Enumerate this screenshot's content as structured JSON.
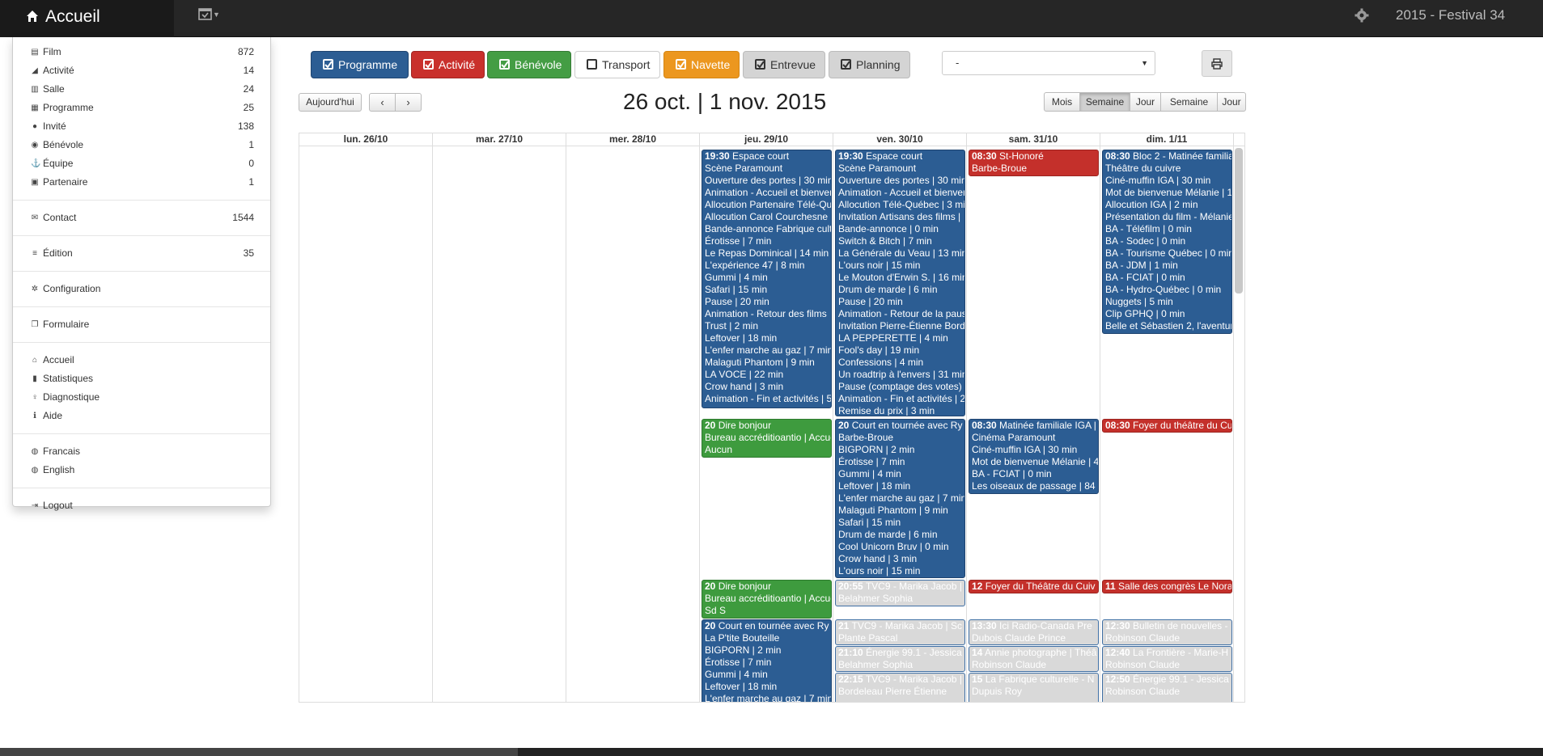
{
  "app": {
    "brand": "Accueil",
    "festival": "2015 - Festival 34"
  },
  "menu": {
    "group1": [
      {
        "label": "Film",
        "count": "872",
        "icon": "film-icon"
      },
      {
        "label": "Activité",
        "count": "14",
        "icon": "bullhorn-icon"
      },
      {
        "label": "Salle",
        "count": "24",
        "icon": "building-icon"
      },
      {
        "label": "Programme",
        "count": "25",
        "icon": "calendar-icon"
      },
      {
        "label": "Invité",
        "count": "138",
        "icon": "user-icon"
      },
      {
        "label": "Bénévole",
        "count": "1",
        "icon": "users-icon"
      },
      {
        "label": "Équipe",
        "count": "0",
        "icon": "anchor-icon"
      },
      {
        "label": "Partenaire",
        "count": "1",
        "icon": "money-icon"
      }
    ],
    "contact": {
      "label": "Contact",
      "count": "1544"
    },
    "edition": {
      "label": "Édition",
      "count": "35"
    },
    "configuration": "Configuration",
    "formulaire": "Formulaire",
    "group2": [
      {
        "label": "Accueil",
        "icon": "home-icon"
      },
      {
        "label": "Statistiques",
        "icon": "bar-chart-icon"
      },
      {
        "label": "Diagnostique",
        "icon": "lightbulb-icon"
      },
      {
        "label": "Aide",
        "icon": "info-icon"
      }
    ],
    "lang": [
      "Francais",
      "English"
    ],
    "logout": "Logout"
  },
  "toolbar": [
    {
      "label": "Programme",
      "bg": "#2c5d93",
      "fg": "#ffffff",
      "border": "#1f4470"
    },
    {
      "label": "Activité",
      "bg": "#c9302c",
      "fg": "#ffffff",
      "border": "#a02622"
    },
    {
      "label": "Bénévole",
      "bg": "#449d44",
      "fg": "#ffffff",
      "border": "#357a35"
    },
    {
      "label": "Transport",
      "bg": "#ffffff",
      "fg": "#333333",
      "border": "#cccccc"
    },
    {
      "label": "Navette",
      "bg": "#ec971f",
      "fg": "#ffffff",
      "border": "#d58512"
    },
    {
      "label": "Entrevue",
      "bg": "#d4d4d4",
      "fg": "#333333",
      "border": "#bbbbbb"
    },
    {
      "label": "Planning",
      "bg": "#d4d4d4",
      "fg": "#333333",
      "border": "#bbbbbb"
    }
  ],
  "select": {
    "value": "-"
  },
  "calendar": {
    "today": "Aujourd'hui",
    "prev": "‹",
    "next": "›",
    "title": "26 oct. | 1 nov. 2015",
    "views": [
      "Mois",
      "Semaine",
      "Jour",
      "Semaine",
      "Jour"
    ],
    "days": [
      "lun. 26/10",
      "mar. 27/10",
      "mer. 28/10",
      "jeu. 29/10",
      "ven. 30/10",
      "sam. 31/10",
      "dim. 1/11"
    ]
  },
  "events": {
    "thu1": {
      "time": "19:30",
      "title": "Espace court",
      "lines": [
        "Scène Paramount",
        "Ouverture des portes | 30 min",
        "Animation - Accueil et bienvenue",
        "Allocution Partenaire Télé-Québec",
        "Allocution Carol Courchesne",
        "Bande-annonce Fabrique culturelle",
        "Érotisse | 7 min",
        "Le Repas Dominical | 14 min",
        "L'expérience 47 | 8 min",
        "Gummi | 4 min",
        "Safari | 15 min",
        "Pause | 20 min",
        "Animation - Retour des films",
        "Trust | 2 min",
        "Leftover | 18 min",
        "L'enfer marche au gaz | 7 min",
        "Malaguti Phantom | 9 min",
        "LA VOCE | 22 min",
        "Crow hand | 3 min",
        "Animation - Fin et activités | 5"
      ]
    },
    "thu2": {
      "time": "20",
      "title": "Dire bonjour",
      "lines": [
        "Bureau accréditioantio | Accueil",
        "Aucun"
      ]
    },
    "thu3": {
      "time": "20",
      "title": "Dire bonjour",
      "lines": [
        "Bureau accréditioantio | Accueil",
        "Sd S"
      ]
    },
    "thu4": {
      "time": "20",
      "title": "Court en tournée avec Ry",
      "lines": [
        "La P'tite Bouteille",
        "BIGPORN | 2 min",
        "Érotisse | 7 min",
        "Gummi | 4 min",
        "Leftover | 18 min",
        "L'enfer marche au gaz | 7 min"
      ]
    },
    "fri1": {
      "time": "19:30",
      "title": "Espace court",
      "lines": [
        "Scène Paramount",
        "Ouverture des portes | 30 min",
        "Animation - Accueil et bienvenue",
        "Allocution Télé-Québec | 3 min",
        "Invitation Artisans des films |",
        "Bande-annonce | 0 min",
        "Switch & Bitch | 7 min",
        "La Générale du Veau | 13 min",
        "L'ours noir | 15 min",
        "Le Mouton d'Erwin S. | 16 min",
        "Drum de marde | 6 min",
        "Pause | 20 min",
        "Animation - Retour de la pause",
        "Invitation Pierre-Étienne Bordeleau",
        "LA PEPPERETTE | 4 min",
        "Fool's day | 19 min",
        "Confessions | 4 min",
        "Un roadtrip à l'envers | 31 min",
        "Pause (comptage des votes)",
        "Animation - Fin et activités | 2",
        "Remise du prix | 3 min"
      ]
    },
    "fri2": {
      "time": "20",
      "title": "Court en tournée avec Ry",
      "lines": [
        "Barbe-Broue",
        "BIGPORN | 2 min",
        "Érotisse | 7 min",
        "Gummi | 4 min",
        "Leftover | 18 min",
        "L'enfer marche au gaz | 7 min",
        "Malaguti Phantom | 9 min",
        "Safari | 15 min",
        "Drum de marde | 6 min",
        "Cool Unicorn Bruv | 0 min",
        "Crow hand | 3 min",
        "L'ours noir | 15 min"
      ]
    },
    "fri3": {
      "time": "20:55",
      "title": "TVC9 - Marika Jacob |",
      "lines": [
        "Belahmer Sophia"
      ]
    },
    "fri4": {
      "time": "21",
      "title": "TVC9 - Marika Jacob | Sc",
      "lines": [
        "Plante Pascal"
      ]
    },
    "fri5": {
      "time": "21:10",
      "title": "Énergie 99.1 - Jessica",
      "lines": [
        "Belahmer Sophia"
      ]
    },
    "fri6": {
      "time": "22:15",
      "title": "TVC9 - Marika Jacob |",
      "lines": [
        "Bordeleau Pierre Étienne"
      ]
    },
    "sat1": {
      "time": "08:30",
      "title": "St-Honoré",
      "lines": [
        "Barbe-Broue"
      ]
    },
    "sat2": {
      "time": "08:30",
      "title": "Matinée familiale IGA |",
      "lines": [
        "Cinéma Paramount",
        "Ciné-muffin IGA | 30 min",
        "Mot de bienvenue Mélanie | 4",
        "BA - FCIAT | 0 min",
        "Les oiseaux de passage | 84"
      ]
    },
    "sat3": {
      "time": "12",
      "title": "Foyer du Théâtre du Cuiv",
      "lines": []
    },
    "sat4": {
      "time": "13:30",
      "title": "Ici Radio-Canada Pre",
      "lines": [
        "Dubois Claude Prince"
      ]
    },
    "sat5": {
      "time": "14",
      "title": "Annie photographe | Théâ",
      "lines": [
        "Robinson Claude"
      ]
    },
    "sat6": {
      "time": "15",
      "title": "La Fabrique culturelle - N",
      "lines": [
        "Dupuis Roy"
      ]
    },
    "sun1": {
      "time": "08:30",
      "title": "Bloc 2 - Matinée familiale",
      "lines": [
        "Théâtre du cuivre",
        "Ciné-muffin IGA | 30 min",
        "Mot de bienvenue Mélanie | 1",
        "Allocution IGA | 2 min",
        "Présentation du film - Mélanie",
        "BA - Téléfilm | 0 min",
        "BA - Sodec | 0 min",
        "BA - Tourisme Québec | 0 min",
        "BA - JDM | 1 min",
        "BA - FCIAT | 0 min",
        "BA - Hydro-Québec | 0 min",
        "Nuggets | 5 min",
        "Clip GPHQ | 0 min",
        "Belle et Sébastien 2, l'aventure"
      ]
    },
    "sun2": {
      "time": "08:30",
      "title": "Foyer du théâtre du Cuiv",
      "lines": []
    },
    "sun3": {
      "time": "11",
      "title": "Salle des congrès Le Nora",
      "lines": []
    },
    "sun4": {
      "time": "12:30",
      "title": "Bulletin de nouvelles -",
      "lines": [
        "Robinson Claude"
      ]
    },
    "sun5": {
      "time": "12:40",
      "title": "La Frontière - Marie-H",
      "lines": [
        "Robinson Claude"
      ]
    },
    "sun6": {
      "time": "12:50",
      "title": "Énergie 99.1 - Jessica",
      "lines": [
        "Robinson Claude"
      ]
    }
  }
}
